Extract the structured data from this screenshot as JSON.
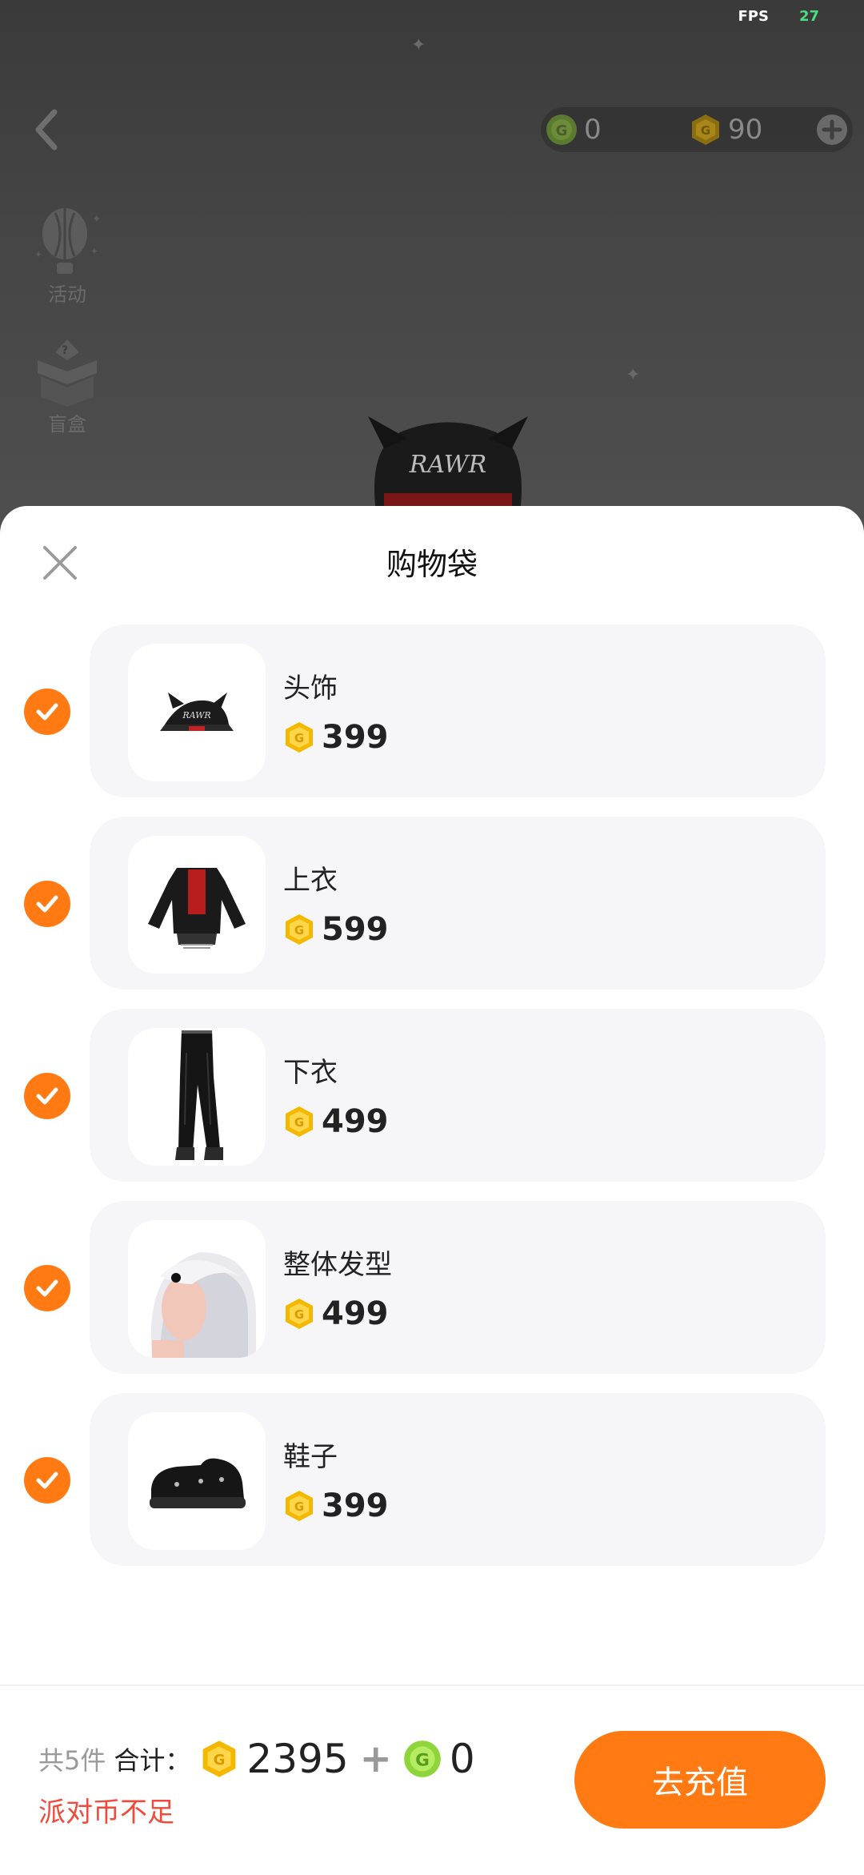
{
  "status": {
    "fps_label": "FPS",
    "fps_value": "27"
  },
  "top_bar": {
    "g_coin_value": "0",
    "party_coin_value": "90"
  },
  "side_menu": {
    "activity_label": "活动",
    "blind_box_label": "盲盒"
  },
  "sheet": {
    "title": "购物袋",
    "items": [
      {
        "name": "头饰",
        "price": "399",
        "checked": true,
        "image": "black-cap"
      },
      {
        "name": "上衣",
        "price": "599",
        "checked": true,
        "image": "black-hoodie"
      },
      {
        "name": "下衣",
        "price": "499",
        "checked": true,
        "image": "black-pants"
      },
      {
        "name": "整体发型",
        "price": "499",
        "checked": true,
        "image": "white-hair"
      },
      {
        "name": "鞋子",
        "price": "399",
        "checked": true,
        "image": "black-shoes"
      }
    ]
  },
  "footer": {
    "count_text": "共5件",
    "total_label": "合计：",
    "party_coin_total": "2395",
    "plus": "+",
    "g_coin_total": "0",
    "warning": "派对币不足",
    "recharge_button": "去充值"
  },
  "colors": {
    "accent": "#ff7a12",
    "warning": "#f04a3a",
    "gold_coin": "#f5b800",
    "green_coin": "#8ed43a"
  },
  "icons": [
    "back-arrow-icon",
    "g-coin-icon",
    "party-coin-icon",
    "plus-circle-icon",
    "balloon-icon",
    "gift-box-icon",
    "close-icon",
    "checkmark-icon"
  ]
}
